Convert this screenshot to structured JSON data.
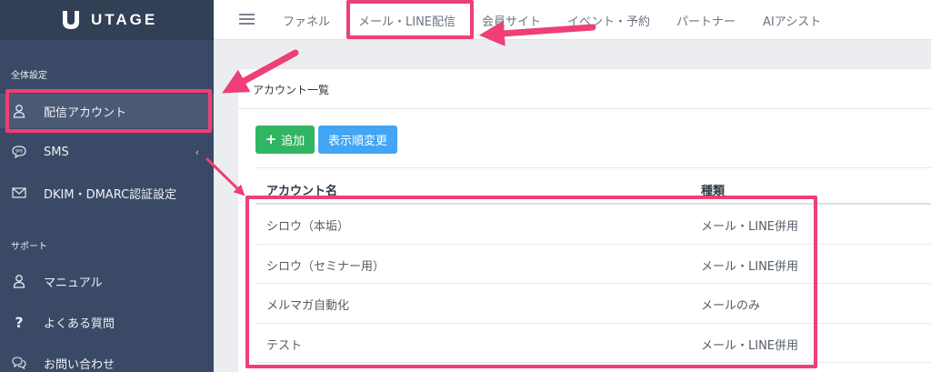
{
  "brand": {
    "name": "UTAGE"
  },
  "sidebar": {
    "sections": [
      {
        "label": "全体設定"
      },
      {
        "label": "サポート"
      }
    ],
    "items": [
      {
        "label": "配信アカウント",
        "icon": "user-icon"
      },
      {
        "label": "SMS",
        "icon": "sms-icon"
      },
      {
        "label": "DKIM・DMARC認証設定",
        "icon": "mail-icon"
      },
      {
        "label": "マニュアル",
        "icon": "user-icon"
      },
      {
        "label": "よくある質問",
        "icon": "question-icon"
      },
      {
        "label": "お問い合わせ",
        "icon": "chat-icon"
      }
    ]
  },
  "topbar": {
    "tabs": [
      {
        "label": "ファネル"
      },
      {
        "label": "メール・LINE配信"
      },
      {
        "label": "会員サイト"
      },
      {
        "label": "イベント・予約"
      },
      {
        "label": "パートナー"
      },
      {
        "label": "AIアシスト"
      }
    ]
  },
  "main": {
    "title": "アカウント一覧",
    "buttons": {
      "add": "追加",
      "sort": "表示順変更"
    },
    "table": {
      "headers": [
        "アカウント名",
        "種類"
      ],
      "rows": [
        [
          "シロウ（本垢）",
          "メール・LINE併用"
        ],
        [
          "シロウ（セミナー用）",
          "メール・LINE併用"
        ],
        [
          "メルマガ自動化",
          "メールのみ"
        ],
        [
          "テスト",
          "メール・LINE併用"
        ]
      ]
    }
  },
  "colors": {
    "sidebar": "#3a4a66",
    "highlight": "#ee3f76",
    "add_button": "#32b563",
    "sort_button": "#42a5f5"
  }
}
